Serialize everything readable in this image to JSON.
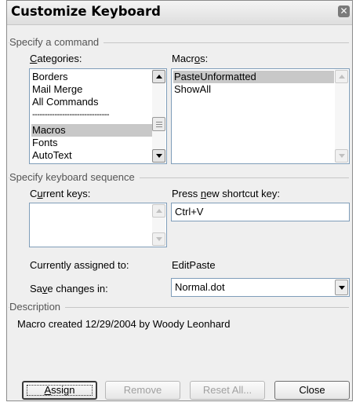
{
  "window": {
    "title": "Customize Keyboard",
    "close_glyph": "✕"
  },
  "command_group": {
    "label": "Specify a command"
  },
  "categories": {
    "label_pre": "",
    "label_u": "C",
    "label_post": "ategories:",
    "items": [
      "Borders",
      "Mail Merge",
      "All Commands",
      "-------------------------------",
      "Macros",
      "Fonts",
      "AutoText"
    ],
    "selected": "Macros"
  },
  "macros": {
    "label_pre": "Macr",
    "label_u": "o",
    "label_post": "s:",
    "items": [
      "PasteUnformatted",
      "ShowAll"
    ],
    "selected": "PasteUnformatted"
  },
  "keyboard_group": {
    "label": "Specify keyboard sequence"
  },
  "current_keys": {
    "label_pre": "C",
    "label_u": "u",
    "label_post": "rrent keys:",
    "items": []
  },
  "new_shortcut": {
    "label_pre": "Press ",
    "label_u": "n",
    "label_post": "ew shortcut key:",
    "value": "Ctrl+V"
  },
  "assigned": {
    "label": "Currently assigned to:",
    "value": "EditPaste"
  },
  "save_changes": {
    "label_pre": "Sa",
    "label_u": "v",
    "label_post": "e changes in:",
    "value": "Normal.dot"
  },
  "description": {
    "label": "Description",
    "text": "Macro created 12/29/2004 by Woody Leonhard"
  },
  "buttons": {
    "assign_pre": "",
    "assign_u": "A",
    "assign_post": "ssign",
    "remove": "Remove",
    "reset_all": "Reset All...",
    "close": "Close"
  }
}
